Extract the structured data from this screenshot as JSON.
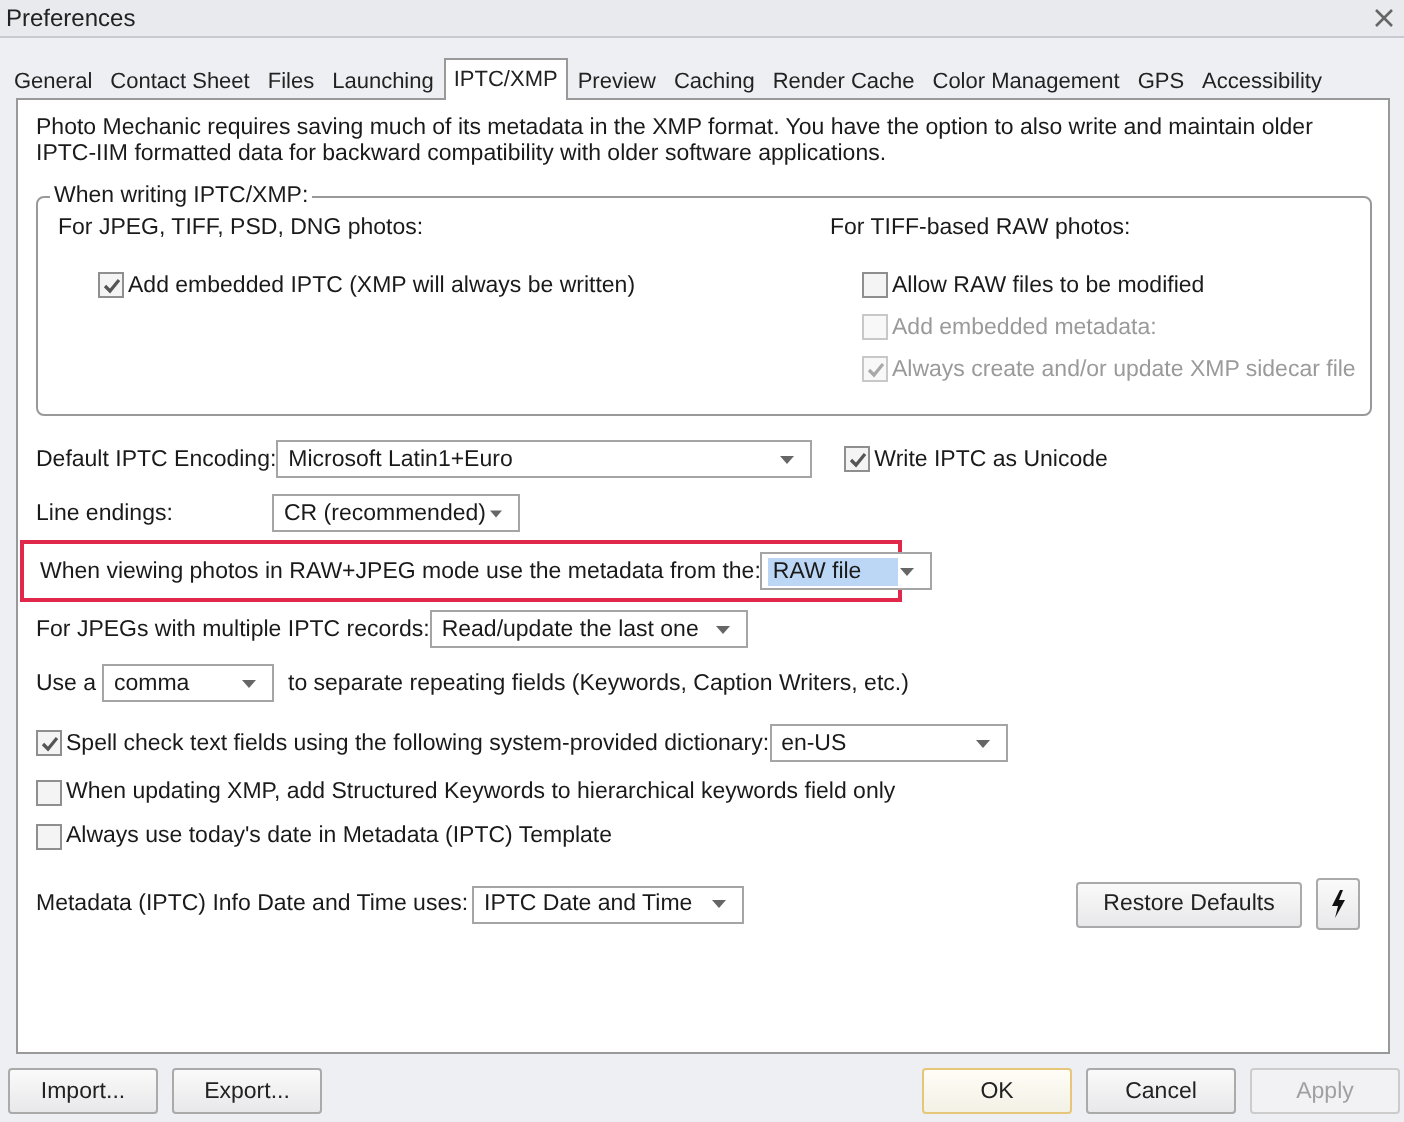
{
  "window": {
    "title": "Preferences"
  },
  "tabs": [
    {
      "label": "General",
      "selected": false
    },
    {
      "label": "Contact Sheet",
      "selected": false
    },
    {
      "label": "Files",
      "selected": false
    },
    {
      "label": "Launching",
      "selected": false
    },
    {
      "label": "IPTC/XMP",
      "selected": true
    },
    {
      "label": "Preview",
      "selected": false
    },
    {
      "label": "Caching",
      "selected": false
    },
    {
      "label": "Render Cache",
      "selected": false
    },
    {
      "label": "Color Management",
      "selected": false
    },
    {
      "label": "GPS",
      "selected": false
    },
    {
      "label": "Accessibility",
      "selected": false
    }
  ],
  "intro": "Photo Mechanic requires saving much of its metadata in the XMP format.  You have the option to also write and maintain older IPTC-IIM formatted data for backward compatibility with older software applications.",
  "writing_group": {
    "legend": "When writing IPTC/XMP:",
    "columns": [
      {
        "heading": "For JPEG, TIFF, PSD, DNG photos:",
        "options": [
          {
            "label": "Add embedded IPTC (XMP will always be written)",
            "checked": true,
            "disabled": false
          }
        ]
      },
      {
        "heading": "For TIFF-based RAW photos:",
        "options": [
          {
            "label": "Allow RAW files to be modified",
            "checked": false,
            "disabled": false
          },
          {
            "label": "Add embedded metadata:",
            "checked": false,
            "disabled": true
          },
          {
            "label": "Always create and/or update XMP sidecar file",
            "checked": true,
            "disabled": true
          }
        ]
      }
    ]
  },
  "encoding": {
    "label": "Default IPTC Encoding:",
    "value": "Microsoft Latin1+Euro"
  },
  "unicode": {
    "label": "Write IPTC as Unicode",
    "checked": true
  },
  "line_endings": {
    "label": "Line endings:",
    "value": "CR (recommended)"
  },
  "raw_jpeg": {
    "label": "When viewing photos in RAW+JPEG mode use the metadata from the:",
    "value": "RAW file",
    "value_selected": true,
    "highlighted": true
  },
  "multiple_records": {
    "label": "For JPEGs with multiple IPTC records:",
    "value": "Read/update the last one"
  },
  "separator": {
    "prefix": "Use a",
    "value": "comma",
    "suffix": "to separate repeating fields (Keywords, Caption Writers, etc.)"
  },
  "spell_check": {
    "label": "Spell check text fields using the following system-provided dictionary:",
    "checked": true,
    "value": "en-US"
  },
  "options": [
    {
      "label": "When updating XMP, add Structured Keywords to hierarchical keywords field only",
      "checked": false
    },
    {
      "label": "Always use today's date in Metadata (IPTC) Template",
      "checked": false
    }
  ],
  "date_time": {
    "label": "Metadata (IPTC) Info Date and Time uses:",
    "value": "IPTC Date and Time"
  },
  "restore_button": "Restore Defaults",
  "footer_left": [
    {
      "label": "Import...",
      "disabled": false
    },
    {
      "label": "Export...",
      "disabled": false
    }
  ],
  "footer_right": [
    {
      "label": "OK",
      "disabled": false,
      "default": true
    },
    {
      "label": "Cancel",
      "disabled": false,
      "default": false
    },
    {
      "label": "Apply",
      "disabled": true,
      "default": false
    }
  ]
}
